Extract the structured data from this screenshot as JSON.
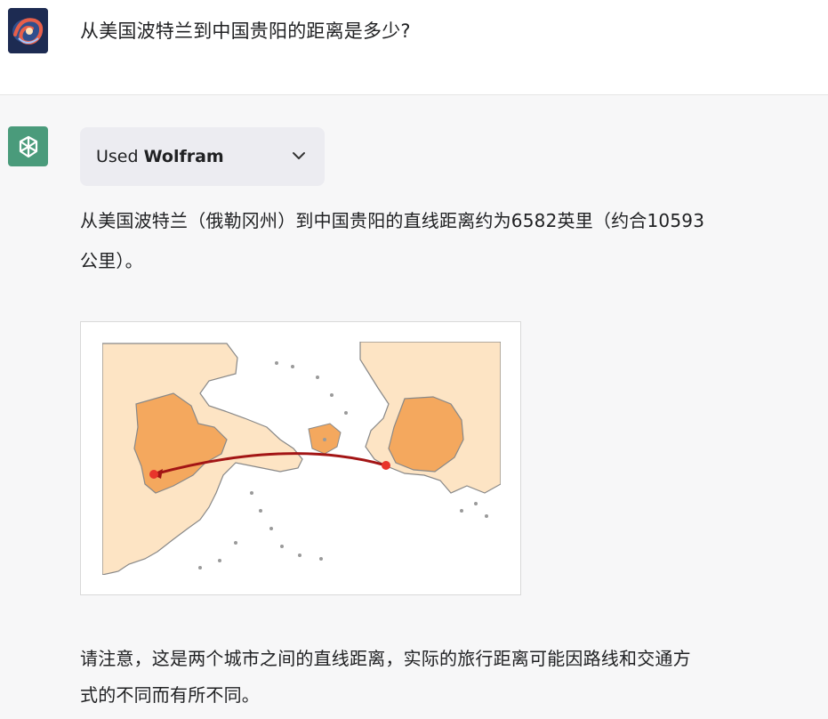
{
  "user": {
    "avatar_icon": "galaxy-avatar",
    "message": "从美国波特兰到中国贵阳的距离是多少?"
  },
  "assistant": {
    "avatar_icon": "openai-logo-icon",
    "plugin": {
      "prefix": "Used",
      "name": "Wolfram",
      "icon": "chevron-down-icon"
    },
    "answer_lines": [
      "从美国波特兰（俄勒冈州）到中国贵阳的直线距离约为6582英里（约合10593",
      "公里）。"
    ],
    "map": {
      "description_icon": "route-map",
      "colors": {
        "land": "#fde4c4",
        "highlight": "#f4a85e",
        "border": "#888888",
        "route": "#a31515",
        "points": "#e8352b"
      }
    },
    "note_lines": [
      "请注意，这是两个城市之间的直线距离，实际的旅行距离可能因路线和交通方",
      "式的不同而有所不同。"
    ]
  }
}
